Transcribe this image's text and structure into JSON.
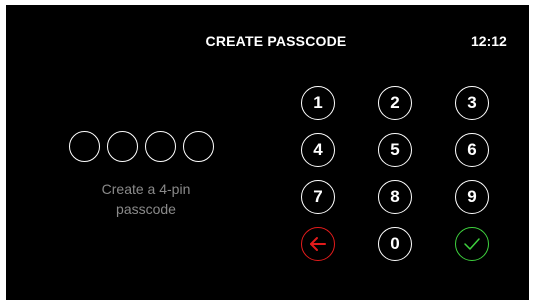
{
  "header": {
    "title": "CREATE PASSCODE",
    "clock": "12:12"
  },
  "pin": {
    "length": 4,
    "filled": 0,
    "hint": "Create a 4-pin\npasscode"
  },
  "keypad": {
    "keys": [
      "1",
      "2",
      "3",
      "4",
      "5",
      "6",
      "7",
      "8",
      "9",
      "0"
    ],
    "backspace_icon": "left-arrow-icon",
    "confirm_icon": "checkmark-icon"
  },
  "colors": {
    "background": "#000000",
    "foreground": "#ffffff",
    "backspace": "#e31b1b",
    "confirm": "#3ed13e",
    "hint": "#8a8a8a"
  }
}
